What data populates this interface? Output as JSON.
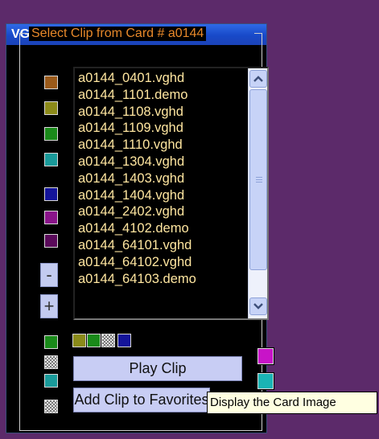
{
  "window": {
    "title": "VGHD Clip Player"
  },
  "group": {
    "legend": "Select Clip from Card # a0144"
  },
  "clip_list": {
    "items": [
      "a0144_0401.vghd",
      "a0144_1101.demo",
      "a0144_1108.vghd",
      "a0144_1109.vghd",
      "a0144_1110.vghd",
      "a0144_1304.vghd",
      "a0144_1403.vghd",
      "a0144_1404.vghd",
      "a0144_2402.vghd",
      "a0144_4102.demo",
      "a0144_64101.vghd",
      "a0144_64102.vghd",
      "a0144_64103.demo"
    ]
  },
  "side_buttons": {
    "minus": "-",
    "plus": "+"
  },
  "buttons": {
    "play": "Play Clip",
    "add_favorites": "Add Clip to Favorites"
  },
  "tooltip": {
    "text": "Display the Card Image"
  },
  "colors": {
    "swatch_column": [
      "#9a5a1a",
      "#8c8a1a",
      "#1a8a1a",
      "#1a9a9a",
      "#14149a",
      "#8a148a",
      "#5a0a5a"
    ],
    "swatch_row": [
      "#8a8a1a",
      "#1a8a1a",
      "checker",
      "#14149a"
    ],
    "swatch_right": [
      "#c814c8",
      "#1ab4b4"
    ],
    "bottom_left": [
      "#1a8a1a",
      "checker",
      "#1a9a9a",
      "checker"
    ]
  },
  "icons": {
    "scroll_up": "chevron-up-icon",
    "scroll_down": "chevron-down-icon"
  }
}
